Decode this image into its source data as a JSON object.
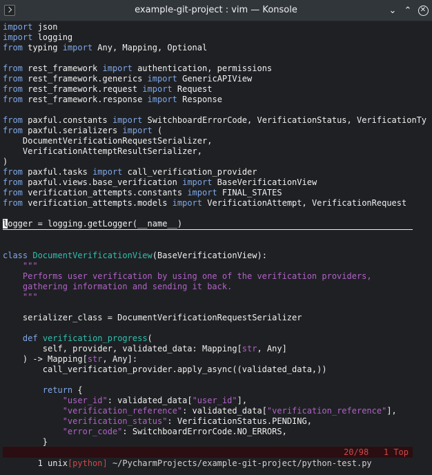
{
  "window": {
    "title": "example-git-project : vim — Konsole",
    "minimize_glyph": "⌄",
    "maximize_glyph": "⌃",
    "close_glyph": "✕"
  },
  "editor": {
    "lines": [
      [
        [
          "import",
          "kw"
        ],
        [
          " json",
          ""
        ]
      ],
      [
        [
          "import",
          "kw"
        ],
        [
          " logging",
          ""
        ]
      ],
      [
        [
          "from",
          "kw"
        ],
        [
          " typing ",
          ""
        ],
        [
          "import",
          "kw"
        ],
        [
          " Any, Mapping, Optional",
          ""
        ]
      ],
      [],
      [
        [
          "from",
          "kw"
        ],
        [
          " rest_framework ",
          ""
        ],
        [
          "import",
          "kw"
        ],
        [
          " authentication, permissions",
          ""
        ]
      ],
      [
        [
          "from",
          "kw"
        ],
        [
          " rest_framework.generics ",
          ""
        ],
        [
          "import",
          "kw"
        ],
        [
          " GenericAPIView",
          ""
        ]
      ],
      [
        [
          "from",
          "kw"
        ],
        [
          " rest_framework.request ",
          ""
        ],
        [
          "import",
          "kw"
        ],
        [
          " Request",
          ""
        ]
      ],
      [
        [
          "from",
          "kw"
        ],
        [
          " rest_framework.response ",
          ""
        ],
        [
          "import",
          "kw"
        ],
        [
          " Response",
          ""
        ]
      ],
      [],
      [
        [
          "from",
          "kw"
        ],
        [
          " paxful.constants ",
          ""
        ],
        [
          "import",
          "kw"
        ],
        [
          " SwitchboardErrorCode, VerificationStatus, VerificationTy",
          ""
        ]
      ],
      [
        [
          "from",
          "kw"
        ],
        [
          " paxful.serializers ",
          ""
        ],
        [
          "import",
          "kw"
        ],
        [
          " (",
          ""
        ]
      ],
      [
        [
          "    DocumentVerificationRequestSerializer,",
          ""
        ]
      ],
      [
        [
          "    VerificationAttemptResultSerializer,",
          ""
        ]
      ],
      [
        [
          ")",
          ""
        ]
      ],
      [
        [
          "from",
          "kw"
        ],
        [
          " paxful.tasks ",
          ""
        ],
        [
          "import",
          "kw"
        ],
        [
          " call_verification_provider",
          ""
        ]
      ],
      [
        [
          "from",
          "kw"
        ],
        [
          " paxful.views.base_verification ",
          ""
        ],
        [
          "import",
          "kw"
        ],
        [
          " BaseVerificationView",
          ""
        ]
      ],
      [
        [
          "from",
          "kw"
        ],
        [
          " verification_attempts.constants ",
          ""
        ],
        [
          "import",
          "kw"
        ],
        [
          " FINAL_STATES",
          ""
        ]
      ],
      [
        [
          "from",
          "kw"
        ],
        [
          " verification_attempts.models ",
          ""
        ],
        [
          "import",
          "kw"
        ],
        [
          " VerificationAttempt, VerificationRequest",
          ""
        ]
      ],
      [],
      [
        [
          "l",
          "cursor"
        ],
        [
          "ogger = logging.getLogger(__name__)",
          ""
        ]
      ],
      [],
      [],
      [
        [
          "class",
          "kw"
        ],
        [
          " ",
          ""
        ],
        [
          "DocumentVerificationView",
          "cls"
        ],
        [
          "(BaseVerificationView):",
          ""
        ]
      ],
      [
        [
          "    \"\"\"",
          "doc"
        ]
      ],
      [
        [
          "    Performs user verification by using one of the verification providers,",
          "doc"
        ]
      ],
      [
        [
          "    gathering information and sending it back.",
          "doc"
        ]
      ],
      [
        [
          "    \"\"\"",
          "doc"
        ]
      ],
      [],
      [
        [
          "    serializer_class = DocumentVerificationRequestSerializer",
          ""
        ]
      ],
      [],
      [
        [
          "    ",
          ""
        ],
        [
          "def",
          "kw"
        ],
        [
          " ",
          ""
        ],
        [
          "verification_progress",
          "fn"
        ],
        [
          "(",
          ""
        ]
      ],
      [
        [
          "        self, provider, validated_data: Mapping[",
          ""
        ],
        [
          "str",
          "bi"
        ],
        [
          ", Any]",
          ""
        ]
      ],
      [
        [
          "    ) -> Mapping[",
          ""
        ],
        [
          "str",
          "bi"
        ],
        [
          ", Any]:",
          ""
        ]
      ],
      [
        [
          "        call_verification_provider.apply_async((validated_data,))",
          ""
        ]
      ],
      [],
      [
        [
          "        ",
          ""
        ],
        [
          "return",
          "kw"
        ],
        [
          " {",
          ""
        ]
      ],
      [
        [
          "            ",
          ""
        ],
        [
          "\"user_id\"",
          "str"
        ],
        [
          ": validated_data[",
          ""
        ],
        [
          "\"user_id\"",
          "str"
        ],
        [
          "],",
          ""
        ]
      ],
      [
        [
          "            ",
          ""
        ],
        [
          "\"verification_reference\"",
          "str"
        ],
        [
          ": validated_data[",
          ""
        ],
        [
          "\"verification_reference\"",
          "str"
        ],
        [
          "],",
          ""
        ]
      ],
      [
        [
          "            ",
          ""
        ],
        [
          "\"verification_status\"",
          "str"
        ],
        [
          ": VerificationStatus.PENDING,",
          ""
        ]
      ],
      [
        [
          "            ",
          ""
        ],
        [
          "\"error_code\"",
          "str"
        ],
        [
          ": SwitchboardErrorCode.NO_ERRORS,",
          ""
        ]
      ],
      [
        [
          "        }",
          ""
        ]
      ]
    ]
  },
  "statusline": {
    "segment_a": " 1 unix",
    "segment_b": "[python]",
    "path": " ~/PycharmProjects/example-git-project/python-test.py",
    "position": "20/98",
    "scroll": "1 Top"
  }
}
